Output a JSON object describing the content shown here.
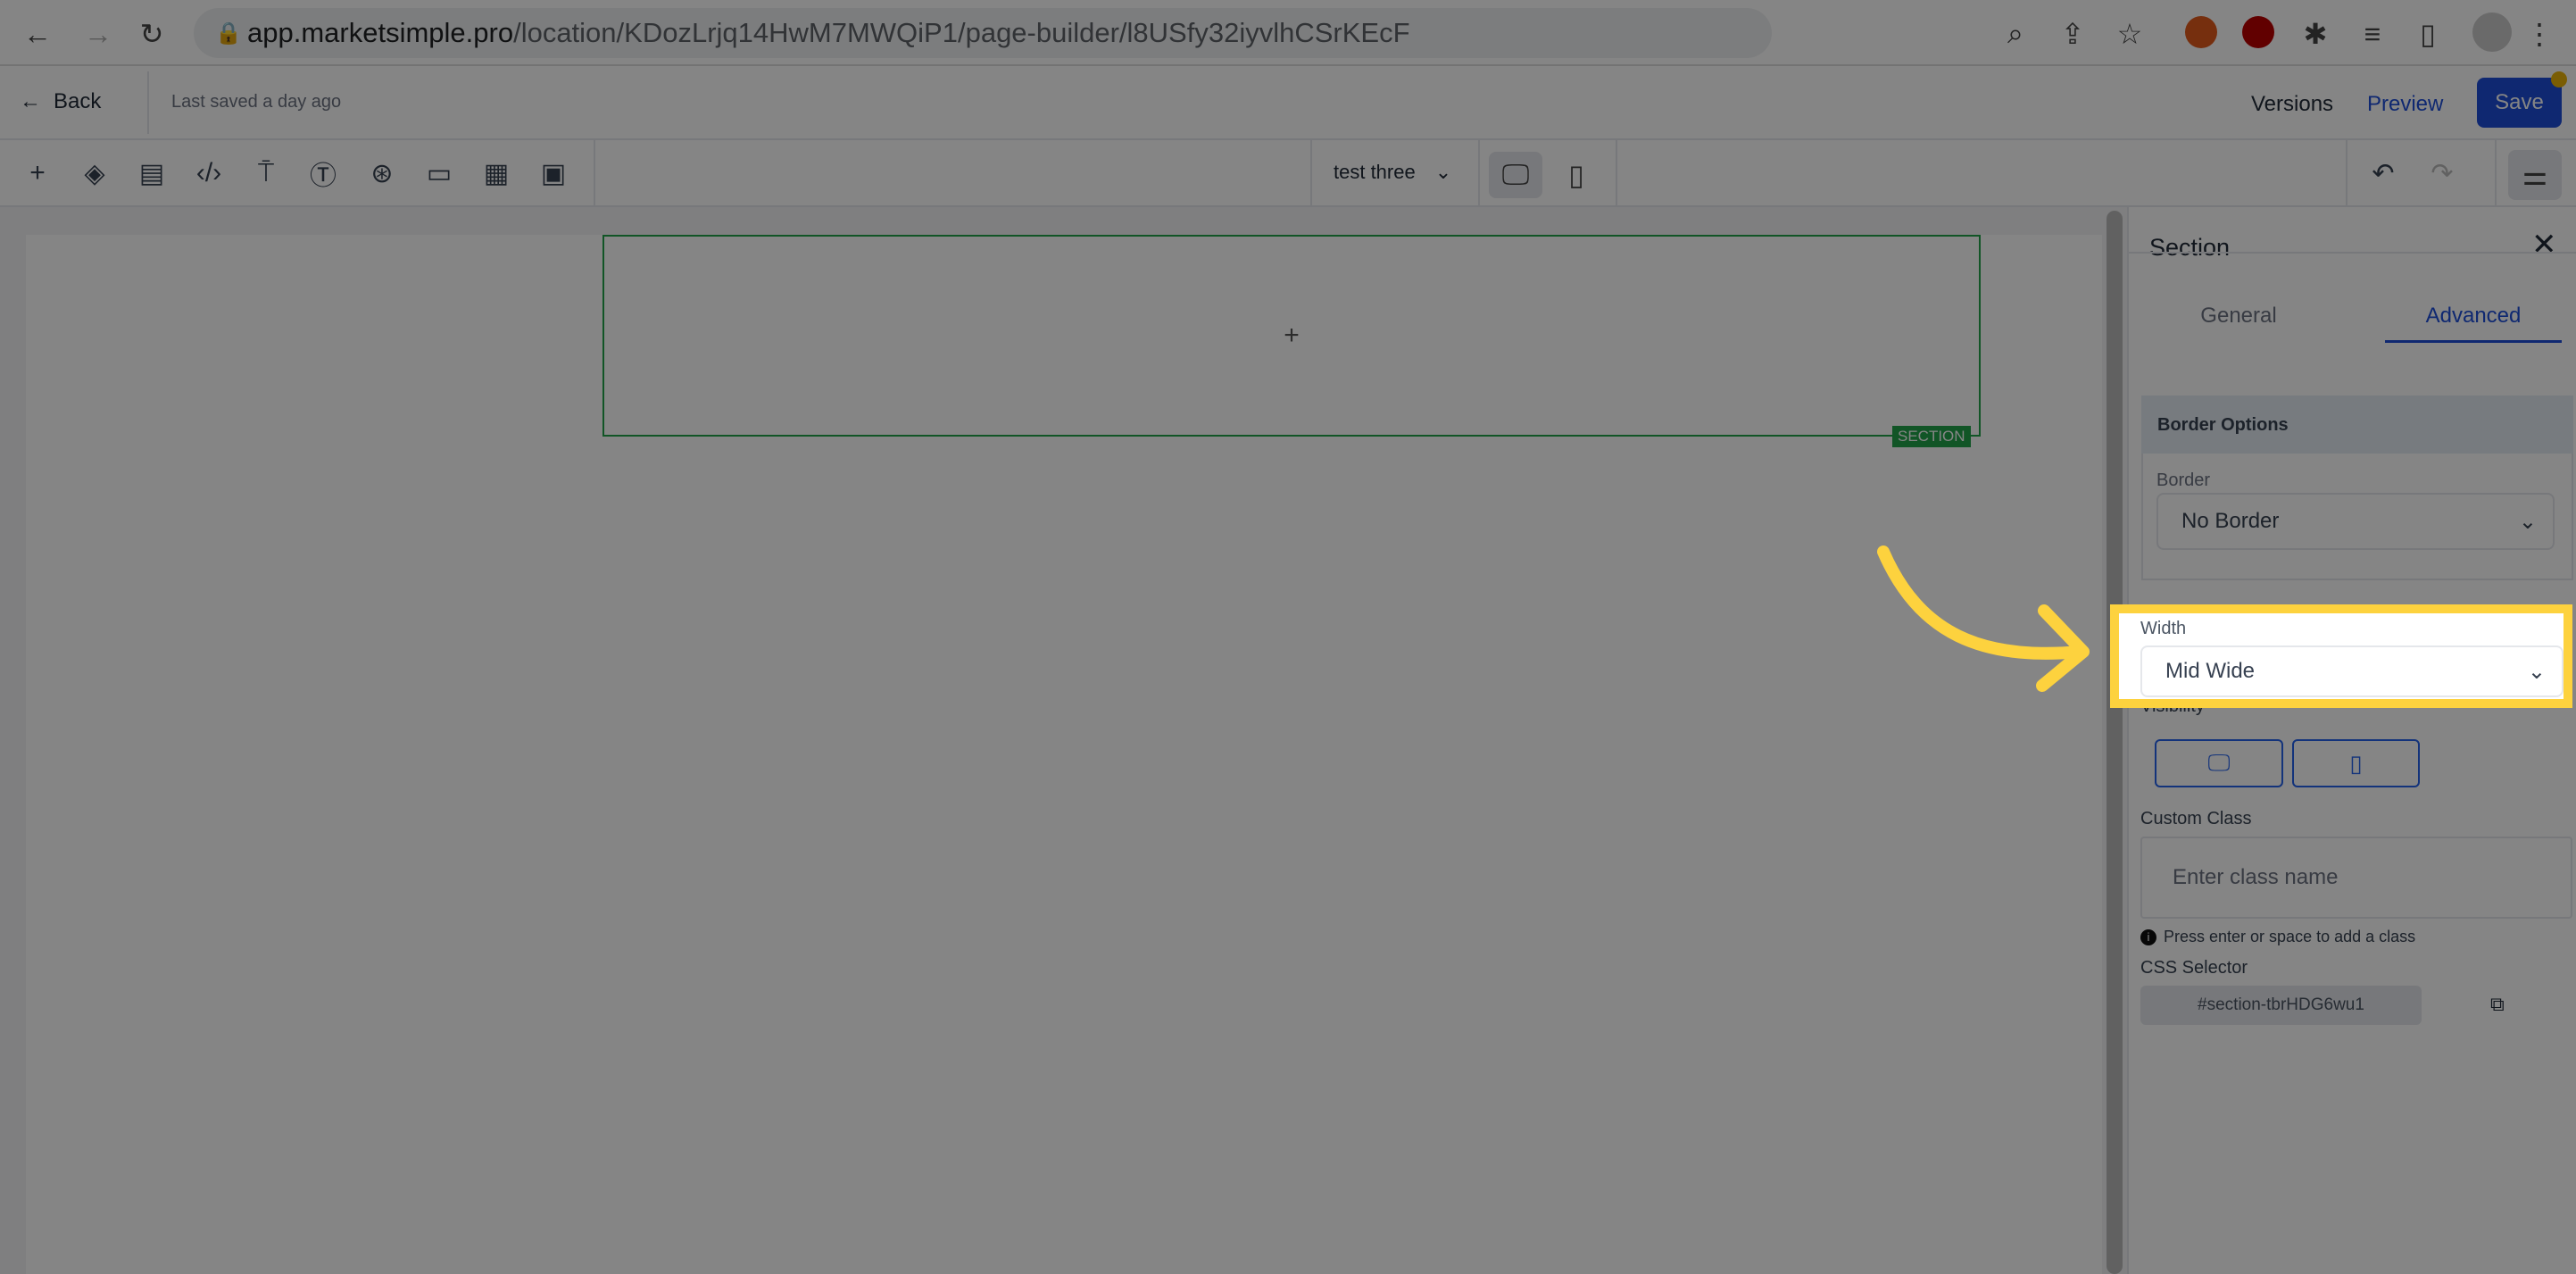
{
  "browser": {
    "url_domain": "app.marketsimple.pro",
    "url_path": "/location/KDozLrjq14HwM7MWQiP1/page-builder/l8USfy32iyvlhCSrKEcF"
  },
  "header": {
    "back_label": "Back",
    "saved_status": "Last saved a day ago",
    "versions_label": "Versions",
    "preview_label": "Preview",
    "save_label": "Save"
  },
  "toolbar": {
    "page_select": "test three"
  },
  "canvas": {
    "add_symbol": "+",
    "section_label": "SECTION"
  },
  "panel": {
    "title": "Section",
    "tabs": [
      {
        "label": "General"
      },
      {
        "label": "Advanced",
        "active": true
      }
    ],
    "border_options": {
      "heading": "Border Options",
      "border_label": "Border",
      "border_value": "No Border"
    },
    "width_label": "Width",
    "width_value": "Mid Wide",
    "visibility_label": "Visibility",
    "custom_class_label": "Custom Class",
    "custom_class_placeholder": "Enter class name",
    "custom_class_hint": "Press enter or space to add a class",
    "css_selector_label": "CSS Selector",
    "css_selector_value": "#section-tbrHDG6wu1"
  },
  "colors": {
    "accent": "#1d4ed8",
    "highlight": "#fdd23e",
    "section_border": "#22a34a"
  }
}
